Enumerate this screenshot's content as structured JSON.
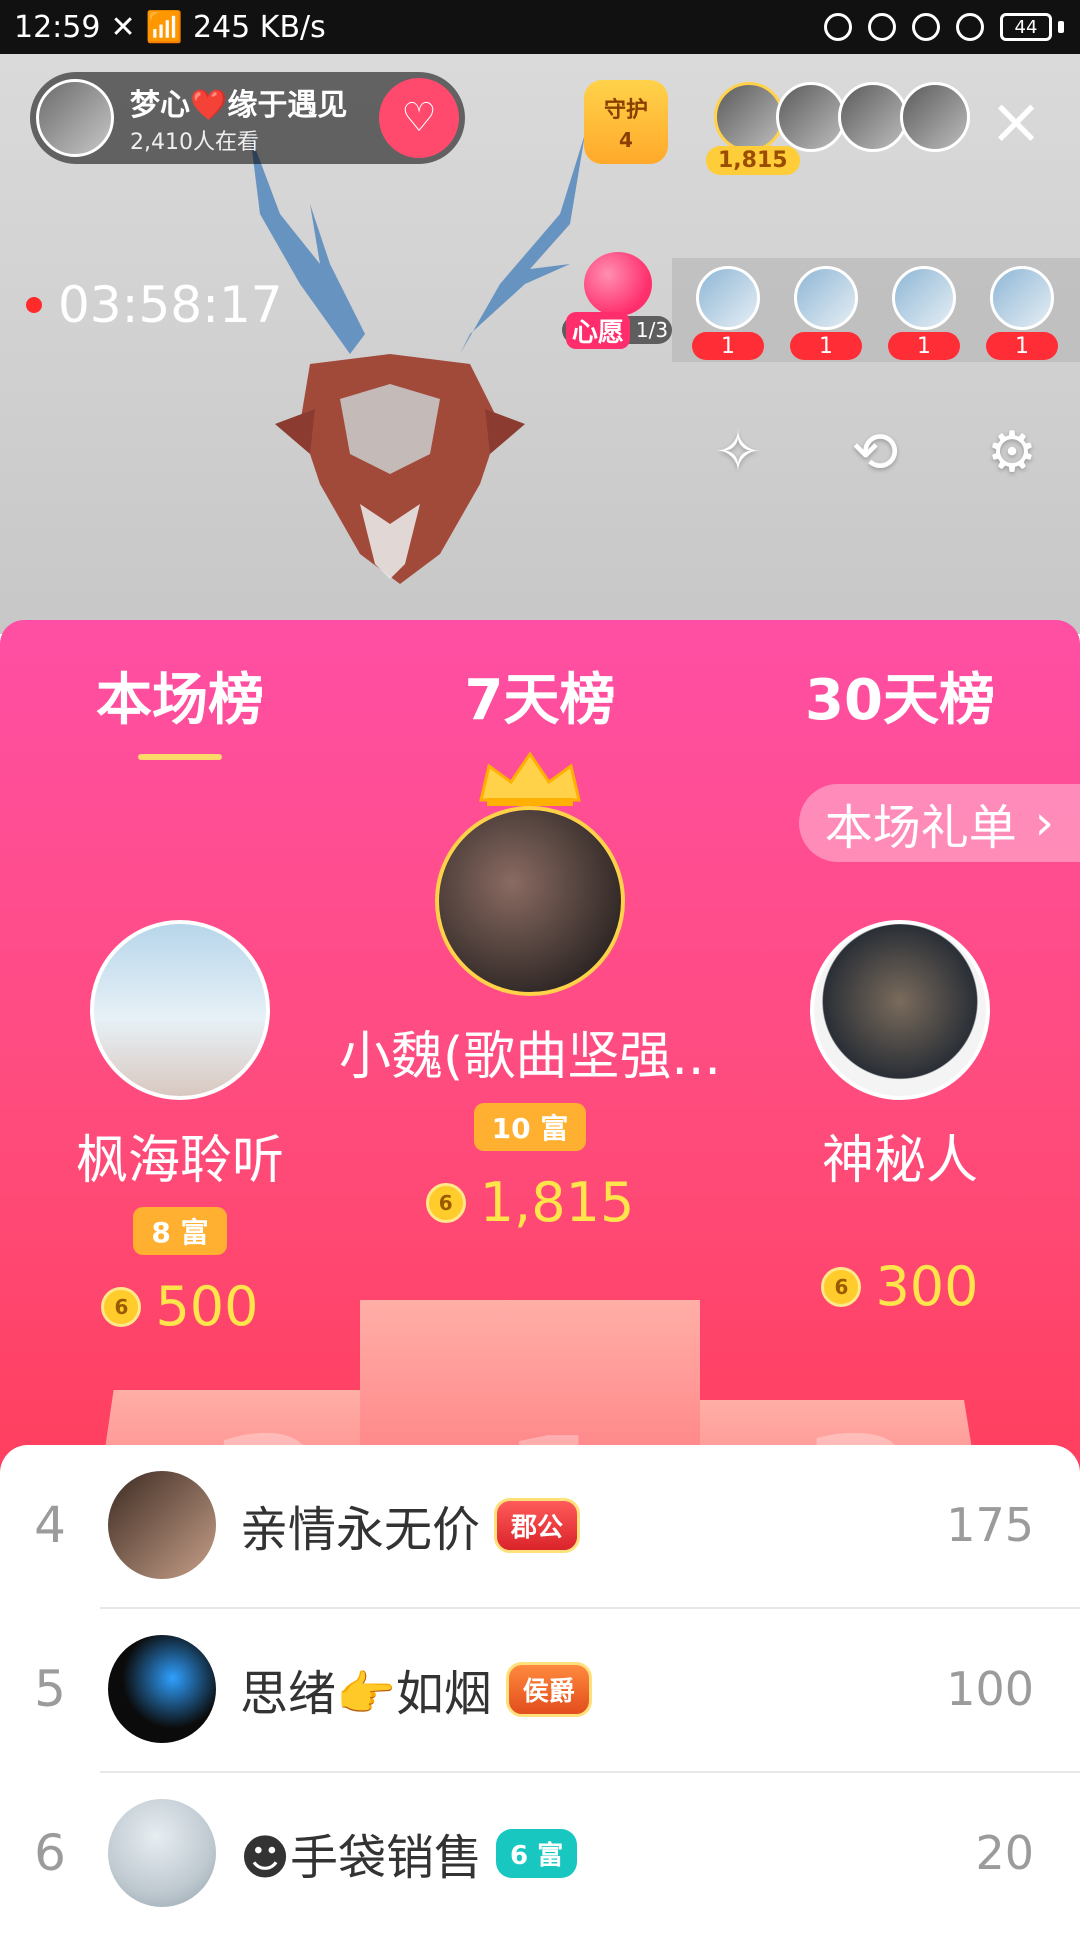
{
  "status_bar": {
    "time": "12:59",
    "speed": "245 KB/s",
    "battery": "44"
  },
  "stream": {
    "host": {
      "name": "梦心❤️缘于遇见",
      "viewers": "2,410人在看"
    },
    "guard": {
      "label": "守护",
      "count": "4"
    },
    "top_contribution": "1,815",
    "elapsed": "03:58:17",
    "wish": {
      "label": "心愿",
      "progress": "1/3"
    },
    "gift_counts": [
      "1",
      "1",
      "1",
      "1"
    ],
    "icons": {
      "follow": "heart-plus-icon",
      "close": "close-icon",
      "magic": "magic-wand-icon",
      "camera_switch": "camera-switch-icon",
      "settings": "gear-icon"
    }
  },
  "panel": {
    "tabs": [
      "本场榜",
      "7天榜",
      "30天榜"
    ],
    "active_tab": 0,
    "gift_list_button": "本场礼单",
    "podium": [
      {
        "place": "1",
        "name": "小魏(歌曲坚强...",
        "rich": "10 富",
        "coins": "1,815"
      },
      {
        "place": "2",
        "name": "枫海聆听",
        "rich": "8 富",
        "coins": "500"
      },
      {
        "place": "3",
        "name": "神秘人",
        "coins": "300"
      }
    ]
  },
  "list": [
    {
      "rank": "4",
      "name": "亲情永无价",
      "tag": "郡公",
      "score": "175"
    },
    {
      "rank": "5",
      "name": "思绪👉如烟",
      "tag": "侯爵",
      "score": "100"
    },
    {
      "rank": "6",
      "name": "☻手袋销售",
      "tag": "6 富",
      "score": "20"
    }
  ],
  "colors": {
    "panel_top": "#ff4fa4",
    "panel_bottom": "#ff3b55",
    "coin_text": "#ffe44b",
    "tab_indicator": "#ffd86b"
  }
}
